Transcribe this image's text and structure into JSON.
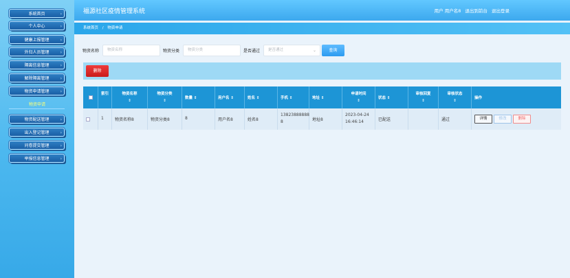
{
  "sidebar": {
    "items": [
      {
        "label": "系统首页"
      },
      {
        "label": "个人中心"
      },
      {
        "label": "健康上报管理"
      },
      {
        "label": "外归人员管理"
      },
      {
        "label": "隔离信息管理"
      },
      {
        "label": "解除隔离管理"
      },
      {
        "label": "物资申请管理"
      },
      {
        "label": "物资配送管理"
      },
      {
        "label": "出入登记管理"
      },
      {
        "label": "问卷提交管理"
      },
      {
        "label": "举报信息管理"
      }
    ],
    "sub_item": "物资申请"
  },
  "header": {
    "title": "福源社区疫情管理系统",
    "user_text": "用户 用户名8",
    "to_frontend": "退出到前台",
    "logout": "退出登录"
  },
  "breadcrumb": {
    "home": "系统首页",
    "sep": "/",
    "current": "物资申请"
  },
  "search": {
    "name_label": "物资名称",
    "name_placeholder": "物资名称",
    "category_label": "物资分类",
    "category_placeholder": "物资分类",
    "pass_label": "是否通过",
    "pass_placeholder": "是否通过",
    "button": "查询"
  },
  "toolbar": {
    "delete_label": "删除"
  },
  "table": {
    "headers": [
      {
        "title": "",
        "sort": ""
      },
      {
        "title": "索引",
        "sort": ""
      },
      {
        "title": "物资名称",
        "sort": "⇕"
      },
      {
        "title": "物资分类",
        "sort": "⇕"
      },
      {
        "title": "数量 ⇕",
        "sort": ""
      },
      {
        "title": "用户名 ⇕",
        "sort": ""
      },
      {
        "title": "姓名 ⇕",
        "sort": ""
      },
      {
        "title": "手机 ⇕",
        "sort": ""
      },
      {
        "title": "地址 ⇕",
        "sort": ""
      },
      {
        "title": "申请时间",
        "sort": "⇕"
      },
      {
        "title": "状态 ⇕",
        "sort": ""
      },
      {
        "title": "审核回复",
        "sort": "⇕"
      },
      {
        "title": "审核状态",
        "sort": "⇕"
      },
      {
        "title": "操作",
        "sort": ""
      }
    ],
    "rows": [
      {
        "index": "1",
        "name": "物资名称8",
        "category": "物资分类8",
        "qty": "8",
        "username": "用户名8",
        "realname": "姓名8",
        "phone_1": "13823888888",
        "phone_2": "8",
        "address": "地址8",
        "date": "2023-04-24",
        "time": "16:46:14",
        "status": "已配送",
        "reply": "",
        "audit": "通过",
        "op_detail": "详情",
        "op_edit": "修改",
        "op_delete": "删除"
      }
    ]
  },
  "colors": {
    "header": "#3ca8ee",
    "table_head": "#1d95d6",
    "delete": "#c91c1c"
  }
}
